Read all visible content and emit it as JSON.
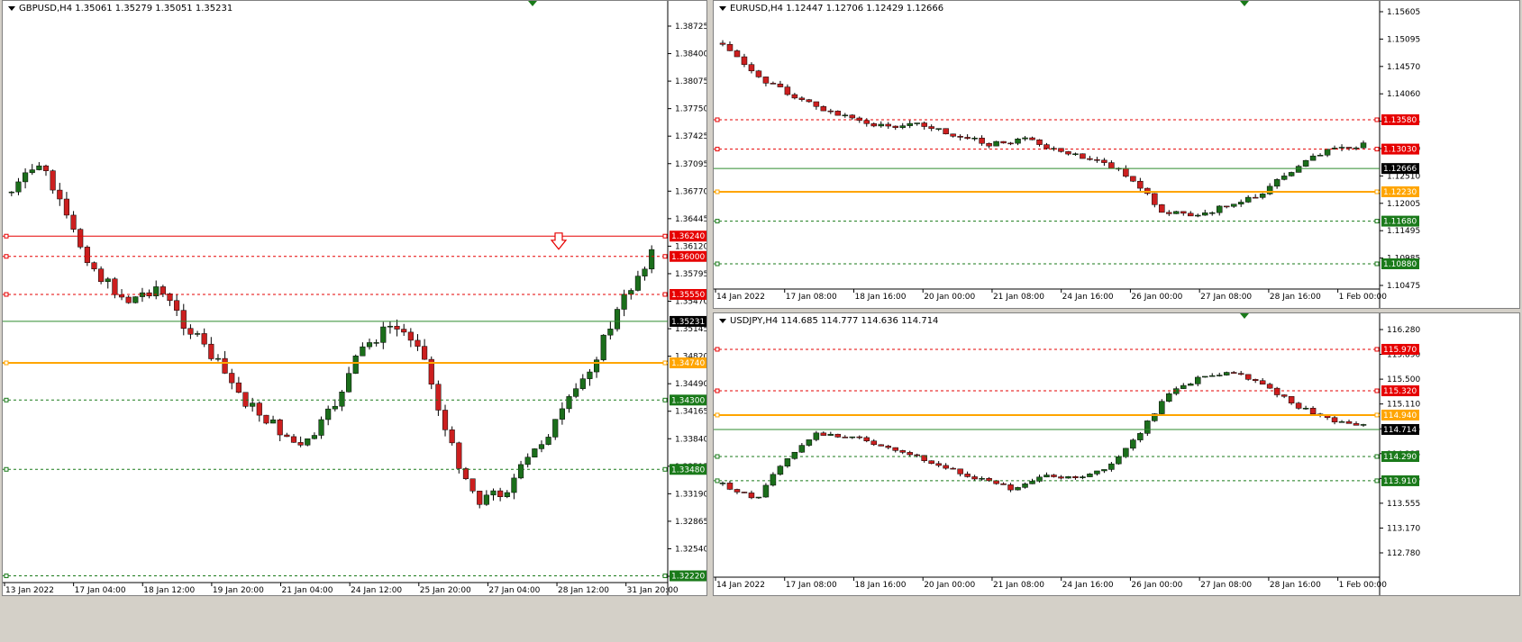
{
  "colors": {
    "background": "#ffffff",
    "frame": "#d4d0c8",
    "bull": "#1b6e1b",
    "bear": "#cc1f1f",
    "wick": "#000000",
    "resistance": "#e60000",
    "support": "#1a7a1a",
    "orange": "#ffa500",
    "current": "#2e8b2e"
  },
  "charts": [
    {
      "id": "gbpusd",
      "title": "GBPUSD,H4  1.35061 1.35279 1.35051 1.35231",
      "price_labels": [
        "1.38725",
        "1.38400",
        "1.38075",
        "1.37750",
        "1.37425",
        "1.37095",
        "1.36770",
        "1.36445",
        "1.36120",
        "1.35795",
        "1.35470",
        "1.35145",
        "1.34820",
        "1.34490",
        "1.34165",
        "1.33840",
        "1.33515",
        "1.33190",
        "1.32865",
        "1.32540",
        "1.32215"
      ],
      "time_labels": [
        "13 Jan 2022",
        "17 Jan 04:00",
        "18 Jan 12:00",
        "19 Jan 20:00",
        "21 Jan 04:00",
        "24 Jan 12:00",
        "25 Jan 20:00",
        "27 Jan 04:00",
        "28 Jan 12:00",
        "31 Jan 20:00"
      ],
      "levels": [
        {
          "value": "1.36240",
          "type": "resistance",
          "style": "solid"
        },
        {
          "value": "1.36000",
          "type": "resistance",
          "style": "dashed"
        },
        {
          "value": "1.35550",
          "type": "resistance",
          "style": "dashed"
        },
        {
          "value": "1.35231",
          "type": "current",
          "style": "solid"
        },
        {
          "value": "1.34740",
          "type": "orange",
          "style": "solid"
        },
        {
          "value": "1.34300",
          "type": "support",
          "style": "dashed"
        },
        {
          "value": "1.33480",
          "type": "support",
          "style": "dashed"
        },
        {
          "value": "1.32220",
          "type": "support",
          "style": "dashed"
        }
      ],
      "arrow_icon": "down-arrow-icon"
    },
    {
      "id": "eurusd",
      "title": "EURUSD,H4  1.12447 1.12706 1.12429 1.12666",
      "price_labels": [
        "1.15605",
        "1.15095",
        "1.14570",
        "1.14060",
        "1.13545",
        "1.13030",
        "1.12510",
        "1.12005",
        "1.11495",
        "1.10985",
        "1.10475"
      ],
      "time_labels": [
        "14 Jan 2022",
        "17 Jan 08:00",
        "18 Jan 16:00",
        "20 Jan 00:00",
        "21 Jan 08:00",
        "24 Jan 16:00",
        "26 Jan 00:00",
        "27 Jan 08:00",
        "28 Jan 16:00",
        "1 Feb 00:00"
      ],
      "levels": [
        {
          "value": "1.13580",
          "type": "resistance",
          "style": "dashed"
        },
        {
          "value": "1.13030",
          "type": "resistance",
          "style": "dashed"
        },
        {
          "value": "1.12666",
          "type": "current",
          "style": "solid"
        },
        {
          "value": "1.12230",
          "type": "orange",
          "style": "solid"
        },
        {
          "value": "1.11680",
          "type": "support",
          "style": "dashed"
        },
        {
          "value": "1.10880",
          "type": "support",
          "style": "dashed"
        }
      ]
    },
    {
      "id": "usdjpy",
      "title": "USDJPY,H4  114.685 114.777 114.636 114.714",
      "price_labels": [
        "116.280",
        "115.890",
        "115.500",
        "115.110",
        "114.725",
        "114.335",
        "113.945",
        "113.555",
        "113.170",
        "112.780"
      ],
      "time_labels": [
        "14 Jan 2022",
        "17 Jan 08:00",
        "18 Jan 16:00",
        "20 Jan 00:00",
        "21 Jan 08:00",
        "24 Jan 16:00",
        "26 Jan 00:00",
        "27 Jan 08:00",
        "28 Jan 16:00",
        "1 Feb 00:00"
      ],
      "levels": [
        {
          "value": "115.970",
          "type": "resistance",
          "style": "dashed"
        },
        {
          "value": "115.320",
          "type": "resistance",
          "style": "dashed"
        },
        {
          "value": "114.940",
          "type": "orange",
          "style": "solid"
        },
        {
          "value": "114.714",
          "type": "current",
          "style": "solid"
        },
        {
          "value": "114.290",
          "type": "support",
          "style": "dashed"
        },
        {
          "value": "113.910",
          "type": "support",
          "style": "dashed"
        }
      ]
    }
  ]
}
